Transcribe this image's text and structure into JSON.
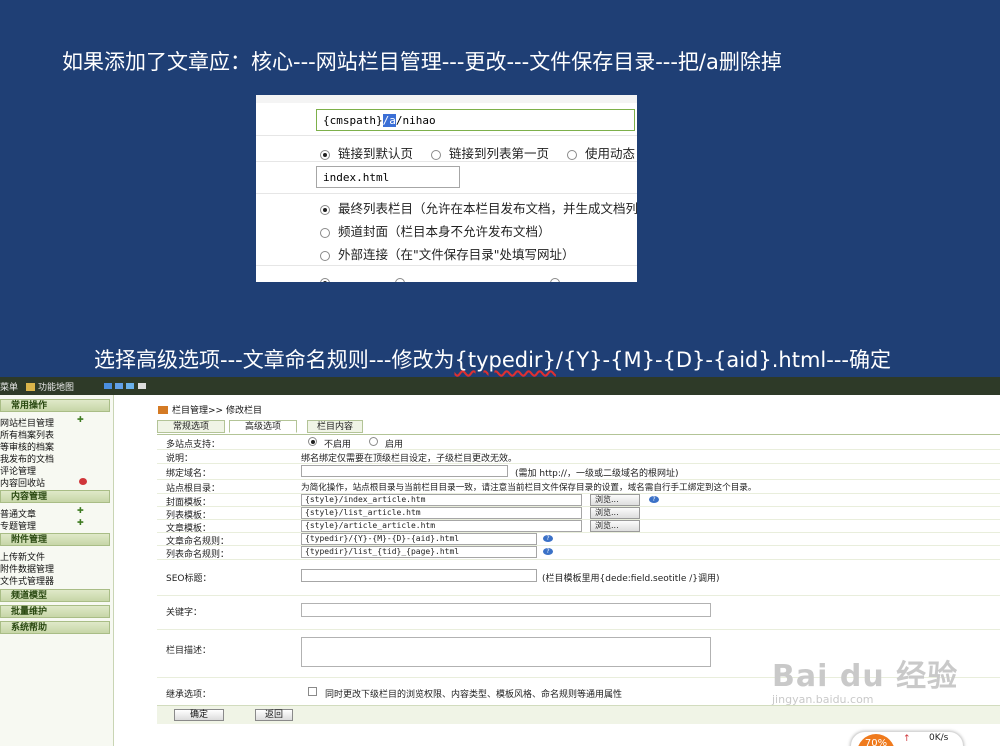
{
  "captions": {
    "step1": "如果添加了文章应：核心---网站栏目管理---更改---文件保存目录---把/a删除掉",
    "step2_prefix": "选择高级选项---文章命名规则---修改为",
    "step2_rule": "{typedir}",
    "step2_suffix": "/{Y}-{M}-{D}-{aid}.html---确定"
  },
  "shot1": {
    "path_prefix": "{cmspath}",
    "path_sel": "/a",
    "path_suffix": "/nihao",
    "link_opts": [
      "链接到默认页",
      "链接到列表第一页",
      "使用动态"
    ],
    "default_page": "index.html",
    "type_opts": [
      "最终列表栏目（允许在本栏目发布文档，并生成文档列",
      "频道封面（栏目本身不允许发布文档）",
      "外部连接（在\"文件保存目录\"处填写网址）"
    ],
    "colors": {
      "accent_input": "#7db04a",
      "selection": "#3b6fd6"
    }
  },
  "app": {
    "topbar": {
      "menu": "菜单",
      "map": "功能地图"
    },
    "sidebar": {
      "sections": [
        "常用操作",
        "内容管理",
        "附件管理",
        "频道模型",
        "批量维护",
        "系统帮助"
      ],
      "common": [
        "网站栏目管理",
        "所有档案列表",
        "等审核的档案",
        "我发布的文档",
        "评论管理",
        "内容回收站"
      ],
      "content": [
        "普通文章",
        "专题管理"
      ],
      "attach": [
        "上传新文件",
        "附件数据管理",
        "文件式管理器"
      ]
    },
    "breadcrumb": "栏目管理>> 修改栏目",
    "tabs": [
      "常规选项",
      "高级选项",
      "栏目内容"
    ],
    "form": {
      "multisite_label": "多站点支持：",
      "multisite_off": "不启用",
      "multisite_on": "启用",
      "note_label": "说明：",
      "note_text": "绑名绑定仅需要在顶级栏目设定，子级栏目更改无效。",
      "domain_label": "绑定域名：",
      "domain_hint": "(需加 http://，一级或二级域名的根网址)",
      "root_label": "站点根目录：",
      "root_text": "为简化操作，站点根目录与当前栏目目录一致，请注意当前栏目文件保存目录的设置，域名需自行手工绑定到这个目录。",
      "index_tpl_label": "封面模板：",
      "index_tpl": "{style}/index_article.htm",
      "list_tpl_label": "列表模板：",
      "list_tpl": "{style}/list_article.htm",
      "article_tpl_label": "文章模板：",
      "article_tpl": "{style}/article_article.htm",
      "browse": "浏览...",
      "naming_label": "文章命名规则：",
      "naming_rule": "{typedir}/{Y}-{M}-{D}-{aid}.html",
      "listrule_label": "列表命名规则：",
      "list_rule": "{typedir}/list_{tid}_{page}.html",
      "seo_label": "SEO标题：",
      "seo_hint": "(栏目模板里用{dede:field.seotitle /}调用)",
      "keywords_label": "关键字：",
      "desc_label": "栏目描述：",
      "inherit_label": "继承选项：",
      "inherit_text": "同时更改下级栏目的浏览权限、内容类型、模板风格、命名规则等通用属性",
      "help_icon": "?"
    },
    "buttons": {
      "ok": "确定",
      "back": "返回"
    }
  },
  "overlay": {
    "watermark": "Bai du 经验",
    "watermark_url": "jingyan.baidu.com",
    "net_percent": "70%",
    "net_arrow": "↑",
    "net_speed": "0K/s"
  },
  "colors": {
    "background": "#1f3f75",
    "sidebar_section": "#c7d6a7",
    "topbar": "#2e3a28",
    "help_icon": "#3b71c7"
  }
}
